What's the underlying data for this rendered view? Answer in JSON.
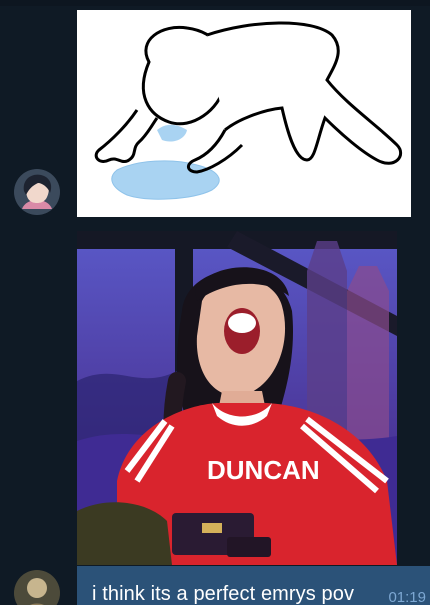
{
  "messages": [
    {
      "type": "sticker",
      "sticker_icon": "crying-figure-sticker",
      "avatar_icon": "user-avatar"
    },
    {
      "type": "photo",
      "photo_icon": "laughing-person-photo",
      "shirt_text": "DUNCAN"
    },
    {
      "type": "text",
      "text": "i think its a perfect emrys pov",
      "time": "01:19",
      "avatar_icon": "user-avatar"
    }
  ],
  "colors": {
    "background": "#0f1a25",
    "bubble": "#2b5278",
    "time": "#7da8d3"
  }
}
